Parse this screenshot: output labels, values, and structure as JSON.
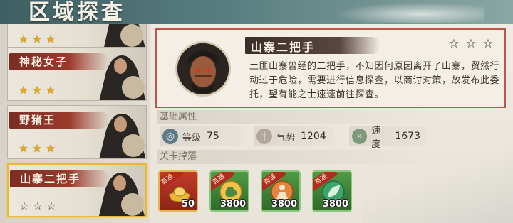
{
  "header": {
    "title": "区域探查"
  },
  "list": {
    "items": [
      {
        "name": "",
        "stars": 3,
        "filled": 3,
        "selected": false
      },
      {
        "name": "神秘女子",
        "stars": 3,
        "filled": 3,
        "selected": false
      },
      {
        "name": "野猪王",
        "stars": 3,
        "filled": 3,
        "selected": false
      },
      {
        "name": "山寨二把手",
        "stars": 3,
        "filled": 0,
        "selected": true
      }
    ]
  },
  "detail": {
    "name": "山寨二把手",
    "stars_filled": 0,
    "description": "土匪山寨曾经的二把手，不知因何原因离开了山寨，贸然行动过于危险，需要进行信息探查，以商讨对策，故发布此委托，望有能之士速速前往探查。",
    "attributes_label": "基础属性",
    "attributes": [
      {
        "label": "等级",
        "value": "75",
        "icon": "level-icon"
      },
      {
        "label": "气势",
        "value": "1204",
        "icon": "momentum-sword-icon"
      },
      {
        "label": "速度",
        "value": "1673",
        "icon": "speed-boot-icon"
      }
    ],
    "drops_label": "关卡掉落",
    "drops": [
      {
        "badge": "首通",
        "count": "50",
        "icon": "gold-ingot-icon"
      },
      {
        "badge": "首通",
        "count": "3800",
        "icon": "muscle-exp-icon"
      },
      {
        "badge": "首通",
        "count": "3800",
        "icon": "figure-exp-icon"
      },
      {
        "badge": "首通",
        "count": "3800",
        "icon": "leaf-exp-icon"
      }
    ]
  },
  "colors": {
    "header": "#4f7275",
    "accent_red": "#9b3a2d",
    "gold": "#e6a81a",
    "selected_border": "#e9b834"
  }
}
